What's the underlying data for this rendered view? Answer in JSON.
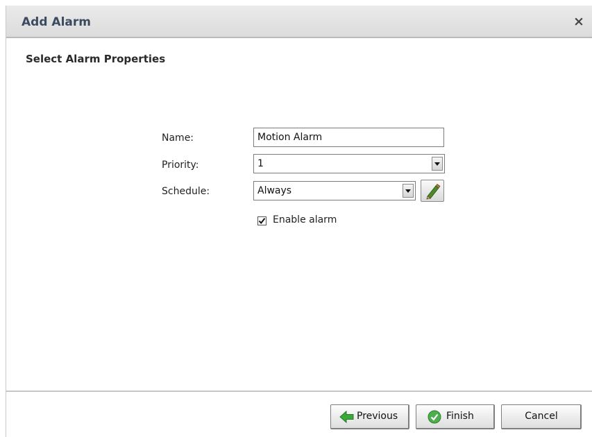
{
  "dialog": {
    "title": "Add Alarm",
    "close_label": "×",
    "section_title": "Select Alarm Properties"
  },
  "form": {
    "name_label": "Name:",
    "name_value": "Motion Alarm",
    "priority_label": "Priority:",
    "priority_value": "1",
    "schedule_label": "Schedule:",
    "schedule_value": "Always",
    "enable_label": "Enable alarm",
    "enable_checked": true
  },
  "buttons": {
    "previous": "Previous",
    "finish": "Finish",
    "cancel": "Cancel"
  },
  "colors": {
    "title_text": "#3b4b5f",
    "previous_icon": "#3aa83a",
    "finish_icon": "#4cae4c"
  },
  "icons": {
    "close": "close-icon",
    "dropdown": "chevron-down-icon",
    "edit": "pencil-icon",
    "previous": "arrow-left-icon",
    "finish": "check-circle-icon"
  }
}
